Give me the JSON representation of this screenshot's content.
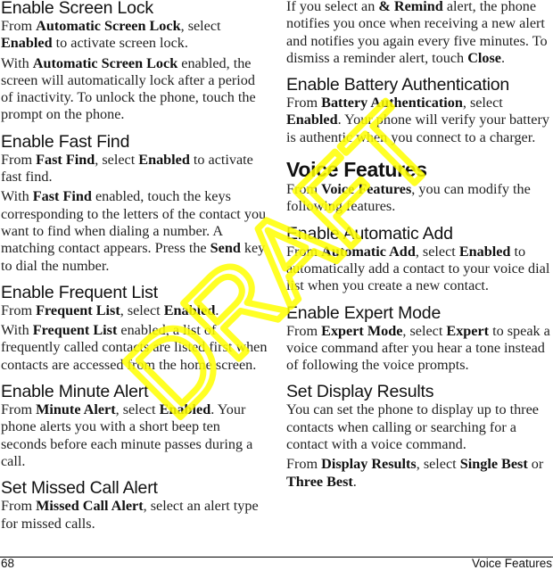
{
  "left_column": {
    "screen_lock": {
      "heading": "Enable Screen Lock",
      "p1": {
        "t1": "From ",
        "b1": "Automatic Screen Lock",
        "t2": ", select ",
        "b2": "Enabled",
        "t3": " to activate screen lock."
      },
      "p2": {
        "t1": "With ",
        "b1": "Automatic Screen Lock",
        "t2": " enabled, the screen will automatically lock after a period of inactivity. To unlock the phone, touch the prompt on the phone."
      }
    },
    "fast_find": {
      "heading": "Enable Fast Find",
      "p1": {
        "t1": "From ",
        "b1": "Fast Find",
        "t2": ", select ",
        "b2": "Enabled",
        "t3": " to activate fast find."
      },
      "p2": {
        "t1": "With ",
        "b1": "Fast Find",
        "t2": " enabled, touch the keys corresponding to the letters of the contact you want to find when dialing a number. A matching contact appears. Press the ",
        "b2": "Send",
        "t3": " key to dial the number."
      }
    },
    "frequent_list": {
      "heading": "Enable Frequent List",
      "p1": {
        "t1": "From ",
        "b1": "Frequent List",
        "t2": ", select ",
        "b2": "Enabled",
        "t3": "."
      },
      "p2": {
        "t1": "With ",
        "b1": "Frequent List",
        "t2": " enabled, a list of frequently called contacts are listed first when contacts are accessed from the home screen."
      }
    },
    "minute_alert": {
      "heading": "Enable Minute Alert",
      "p1": {
        "t1": "From ",
        "b1": "Minute Alert",
        "t2": ", select ",
        "b2": "Enabled",
        "t3": ". Your phone alerts you with a short beep ten seconds before each minute passes during a call."
      }
    },
    "missed_call": {
      "heading": "Set Missed Call Alert",
      "p1": {
        "t1": "From ",
        "b1": "Missed Call Alert",
        "t2": ", select an alert type for missed calls."
      }
    }
  },
  "right_column": {
    "remind": {
      "p1": {
        "t1": "If you select an ",
        "b1": "& Remind",
        "t2": " alert, the phone notifies you once when receiving a new alert and notifies you again every five minutes. To dismiss a reminder alert, touch ",
        "b2": "Close",
        "t3": "."
      }
    },
    "battery_auth": {
      "heading": "Enable Battery Authentication",
      "p1": {
        "t1": "From ",
        "b1": "Battery Authentication",
        "t2": ", select ",
        "b2": "Enabled",
        "t3": ". Your phone will verify your battery is authentic when you connect to a charger."
      }
    },
    "voice_features": {
      "heading": "Voice Features",
      "p1": {
        "t1": "From ",
        "b1": "Voice Features",
        "t2": ", you can modify the following features."
      }
    },
    "automatic_add": {
      "heading": "Enable Automatic Add",
      "p1": {
        "t1": "From ",
        "b1": "Automatic Add",
        "t2": ", select ",
        "b2": "Enabled",
        "t3": " to automatically add a contact to your voice dial list when you create a new contact."
      }
    },
    "expert_mode": {
      "heading": "Enable Expert Mode",
      "p1": {
        "t1": "From ",
        "b1": "Expert Mode",
        "t2": ", select ",
        "b2": "Expert",
        "t3": " to speak a voice command after you hear a tone instead of following the voice prompts."
      }
    },
    "display_results": {
      "heading": "Set Display Results",
      "p1": {
        "t1": "You can set the phone to display up to three contacts when calling or searching for a contact with a voice command."
      },
      "p2": {
        "t1": "From ",
        "b1": "Display Results",
        "t2": ", select ",
        "b2": "Single Best",
        "t3": " or ",
        "b3": "Three Best",
        "t4": "."
      }
    }
  },
  "footer": {
    "page_number": "68",
    "section_title": "Voice Features"
  },
  "watermark": {
    "text": "DRAFT",
    "color": "#ffff00"
  }
}
